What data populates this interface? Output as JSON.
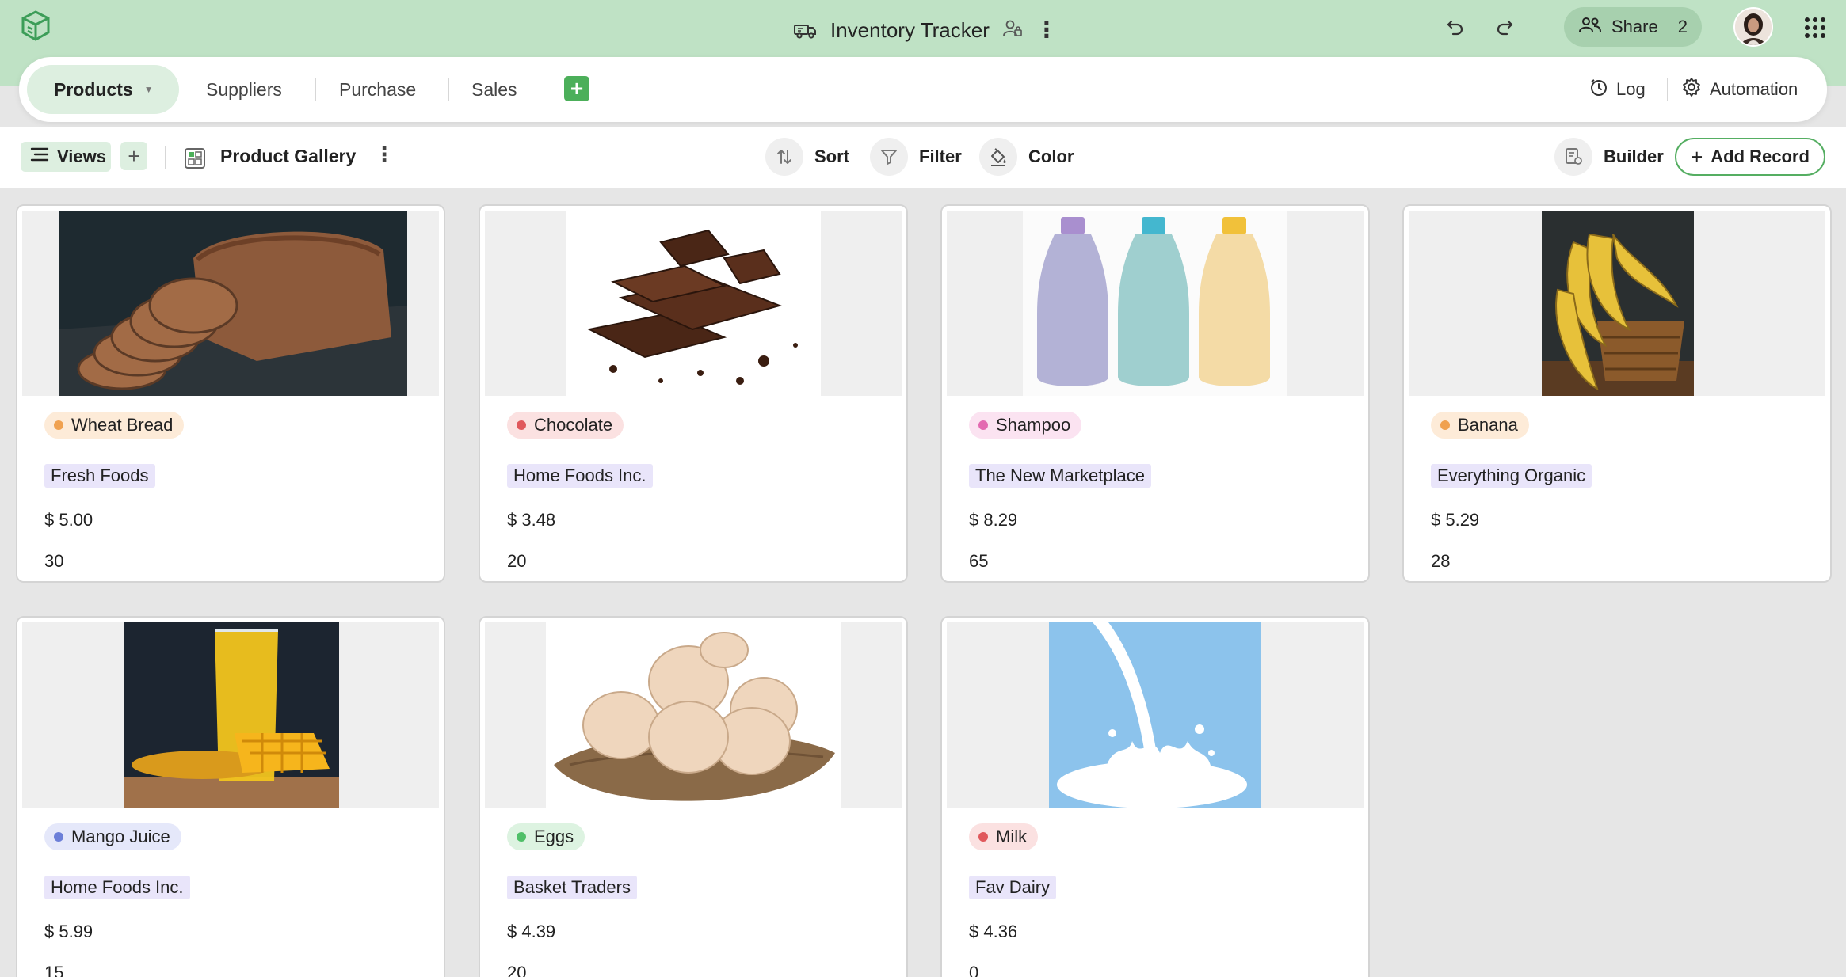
{
  "header": {
    "app_title": "Inventory Tracker",
    "share_label": "Share",
    "share_count": "2"
  },
  "tabs": [
    {
      "label": "Products",
      "active": true
    },
    {
      "label": "Suppliers"
    },
    {
      "label": "Purchase"
    },
    {
      "label": "Sales"
    }
  ],
  "tab_actions": {
    "log": "Log",
    "automation": "Automation"
  },
  "toolbar": {
    "views_label": "Views",
    "view_name": "Product Gallery",
    "sort": "Sort",
    "filter": "Filter",
    "color": "Color",
    "builder": "Builder",
    "add_record": "Add Record"
  },
  "colors": {
    "header_bg": "#bfe2c5",
    "active_tab_bg": "#ddefe0",
    "accent_green": "#4caf5a",
    "supplier_tag_bg": "#e9e5fa"
  },
  "icons": {
    "logo": "cube-logo-icon",
    "title": "truck-icon",
    "undo": "undo-icon",
    "redo": "redo-icon",
    "share": "users-icon",
    "apps": "grid-dots-icon",
    "log": "clock-icon",
    "automation": "gear-icon",
    "sort": "sort-arrows-icon",
    "filter": "funnel-icon",
    "color": "paint-bucket-icon",
    "builder": "builder-icon"
  },
  "products": [
    {
      "name": "Wheat Bread",
      "dot": "#f0a14f",
      "chip_bg": "#fdebd8",
      "supplier": "Fresh Foods",
      "price": "$ 5.00",
      "qty": "30"
    },
    {
      "name": "Chocolate",
      "dot": "#e0585c",
      "chip_bg": "#fbe1e1",
      "supplier": "Home Foods Inc.",
      "price": "$ 3.48",
      "qty": "20"
    },
    {
      "name": "Shampoo",
      "dot": "#e36ab1",
      "chip_bg": "#fbe3f1",
      "supplier": "The New Marketplace",
      "price": "$ 8.29",
      "qty": "65"
    },
    {
      "name": "Banana",
      "dot": "#f0a14f",
      "chip_bg": "#fdebd8",
      "supplier": "Everything Organic",
      "price": "$ 5.29",
      "qty": "28"
    },
    {
      "name": "Mango Juice",
      "dot": "#6c7fd8",
      "chip_bg": "#e5e8fa",
      "supplier": "Home Foods Inc.",
      "price": "$ 5.99",
      "qty": "15"
    },
    {
      "name": "Eggs",
      "dot": "#4fbf68",
      "chip_bg": "#ddf3e1",
      "supplier": "Basket Traders",
      "price": "$ 4.39",
      "qty": "20"
    },
    {
      "name": "Milk",
      "dot": "#e0585c",
      "chip_bg": "#fbe1e1",
      "supplier": "Fav Dairy",
      "price": "$ 4.36",
      "qty": "0"
    }
  ]
}
